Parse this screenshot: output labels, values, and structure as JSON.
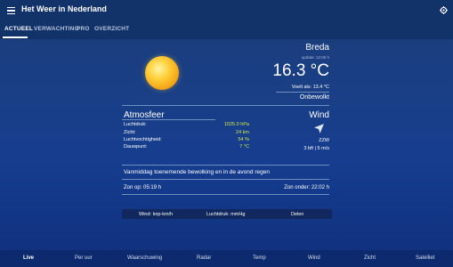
{
  "app": {
    "title": "Het Weer in Nederland"
  },
  "tabs": [
    {
      "label": "ACTUEEL",
      "active": true
    },
    {
      "label": "VERWACHTING",
      "active": false
    },
    {
      "label": "PRO",
      "active": false
    },
    {
      "label": "OVERZICHT",
      "active": false
    }
  ],
  "current": {
    "city": "Breda",
    "update": "update: 12:05 h",
    "temperature": "16.3 °C",
    "feels_like": "Voelt als: 13.4 °C",
    "condition": "Onbewolkt",
    "icon": "sun-icon"
  },
  "atmosphere": {
    "title": "Atmosfeer",
    "rows": [
      {
        "label": "Luchtdruk:",
        "value": "1025.0 hPa"
      },
      {
        "label": "Zicht:",
        "value": "24 km"
      },
      {
        "label": "Luchtvochtigheid:",
        "value": "54 %"
      },
      {
        "label": "Dauwpunt:",
        "value": "7 °C"
      }
    ]
  },
  "wind": {
    "title": "Wind",
    "direction": "ZZW",
    "speed": "3 bft | 5 m/s",
    "icon": "wind-direction-icon"
  },
  "forecast_text": "Vanmiddag toenemende bewolking en in de avond regen",
  "sun": {
    "sunrise": "Zon op: 05:19 h",
    "sunset": "Zon onder: 22:02 h"
  },
  "options": {
    "wind_unit": "Wind: knp-km/h",
    "pressure_unit": "Luchtdruk: mmHg",
    "share": "Delen"
  },
  "bottom_nav": [
    {
      "label": "Live",
      "active": true
    },
    {
      "label": "Per uur",
      "active": false
    },
    {
      "label": "Waarschuwing",
      "active": false
    },
    {
      "label": "Radar",
      "active": false
    },
    {
      "label": "Temp",
      "active": false
    },
    {
      "label": "Wind",
      "active": false
    },
    {
      "label": "Zicht",
      "active": false
    },
    {
      "label": "Satelliet",
      "active": false
    }
  ],
  "colors": {
    "background": "#1a3f86",
    "appbar": "#12326a",
    "value_accent": "#cfe84a",
    "sun": "#f3a316"
  }
}
